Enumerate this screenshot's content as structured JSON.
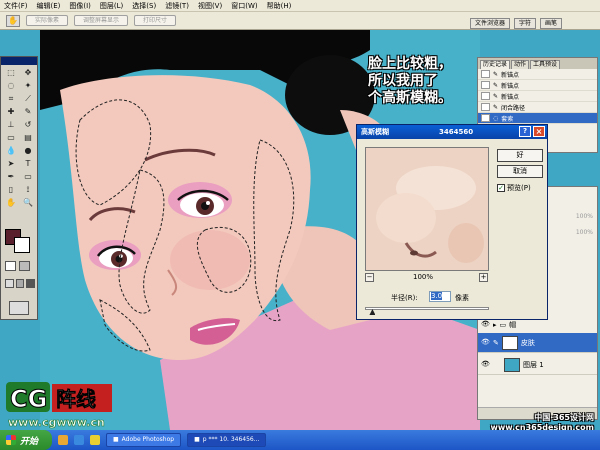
{
  "menu": [
    "文件(F)",
    "编辑(E)",
    "图像(I)",
    "图层(L)",
    "选择(S)",
    "滤镜(T)",
    "视图(V)",
    "窗口(W)",
    "帮助(H)"
  ],
  "options_bar": {
    "buttons": [
      "实际像素",
      "调整屏幕显示",
      "打印尺寸"
    ]
  },
  "palette_well_tabs": [
    "文件浏览器",
    "字符",
    "画笔"
  ],
  "caption": [
    "脸上比较粗，",
    "所以我用了",
    "个高斯模糊。"
  ],
  "dialog": {
    "title": "高斯模糊",
    "info": "3464560",
    "help_icon": "?",
    "close_icon": "×",
    "ok_label": "好",
    "cancel_label": "取消",
    "preview_label": "预览(P)",
    "preview_checked": true,
    "zoom_out": "−",
    "zoom_in": "+",
    "zoom_level": "100%",
    "radius_label": "半径(R):",
    "radius_value": "3.0",
    "radius_unit": "像素",
    "slider_fraction": 0.06
  },
  "history": {
    "tabs": [
      "历史记录",
      "动作",
      "工具预设"
    ],
    "items": [
      "新锚点",
      "新锚点",
      "新锚点",
      "闭合路径",
      "套索"
    ]
  },
  "layers": {
    "items": [
      {
        "name": "帽",
        "type": "group"
      },
      {
        "name": "皮肤",
        "type": "layer",
        "selected": true
      },
      {
        "name": "图层 1",
        "type": "layer"
      }
    ],
    "partial_values": [
      "100%",
      "100%"
    ]
  },
  "taskbar": {
    "start": "开始",
    "items": [
      "Adobe Photoshop",
      "p *** 10. 346456..."
    ]
  },
  "logo": {
    "cg": "CG",
    "cn": "阵线",
    "url": "www.cgwww.cn"
  },
  "watermark_right": [
    "中国·365设计网",
    "www.cn365design.com"
  ]
}
